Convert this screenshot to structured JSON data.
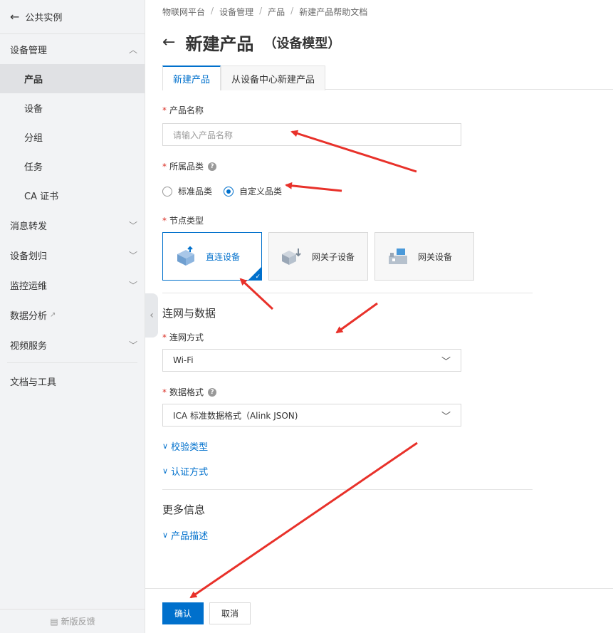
{
  "sidebar": {
    "back_label": "公共实例",
    "sections": [
      {
        "label": "设备管理",
        "expanded": true
      },
      {
        "label": "消息转发",
        "expanded": false
      },
      {
        "label": "设备划归",
        "expanded": false
      },
      {
        "label": "监控运维",
        "expanded": false
      },
      {
        "label": "数据分析",
        "expanded": false
      },
      {
        "label": "视频服务",
        "expanded": false
      }
    ],
    "items": [
      "产品",
      "设备",
      "分组",
      "任务",
      "CA 证书"
    ],
    "docs_label": "文档与工具",
    "feedback_label": "新版反馈"
  },
  "breadcrumb": [
    "物联网平台",
    "设备管理",
    "产品",
    "新建产品帮助文档"
  ],
  "page": {
    "title": "新建产品",
    "subtitle": "（设备模型）"
  },
  "tabs": [
    "新建产品",
    "从设备中心新建产品"
  ],
  "form": {
    "product_name": {
      "label": "产品名称",
      "placeholder": "请输入产品名称"
    },
    "category": {
      "label": "所属品类",
      "options": [
        "标准品类",
        "自定义品类"
      ],
      "selected": "自定义品类"
    },
    "node_type": {
      "label": "节点类型",
      "options": [
        "直连设备",
        "网关子设备",
        "网关设备"
      ],
      "selected": "直连设备"
    },
    "network_section": "连网与数据",
    "network_method": {
      "label": "连网方式",
      "value": "Wi-Fi"
    },
    "data_format": {
      "label": "数据格式",
      "value": "ICA 标准数据格式（Alink JSON)"
    },
    "validation_type": "校验类型",
    "auth_method": "认证方式",
    "more_section": "更多信息",
    "product_desc": "产品描述"
  },
  "footer": {
    "confirm": "确认",
    "cancel": "取消"
  },
  "colors": {
    "accent": "#0070cc",
    "annotation": "#e8312a"
  }
}
